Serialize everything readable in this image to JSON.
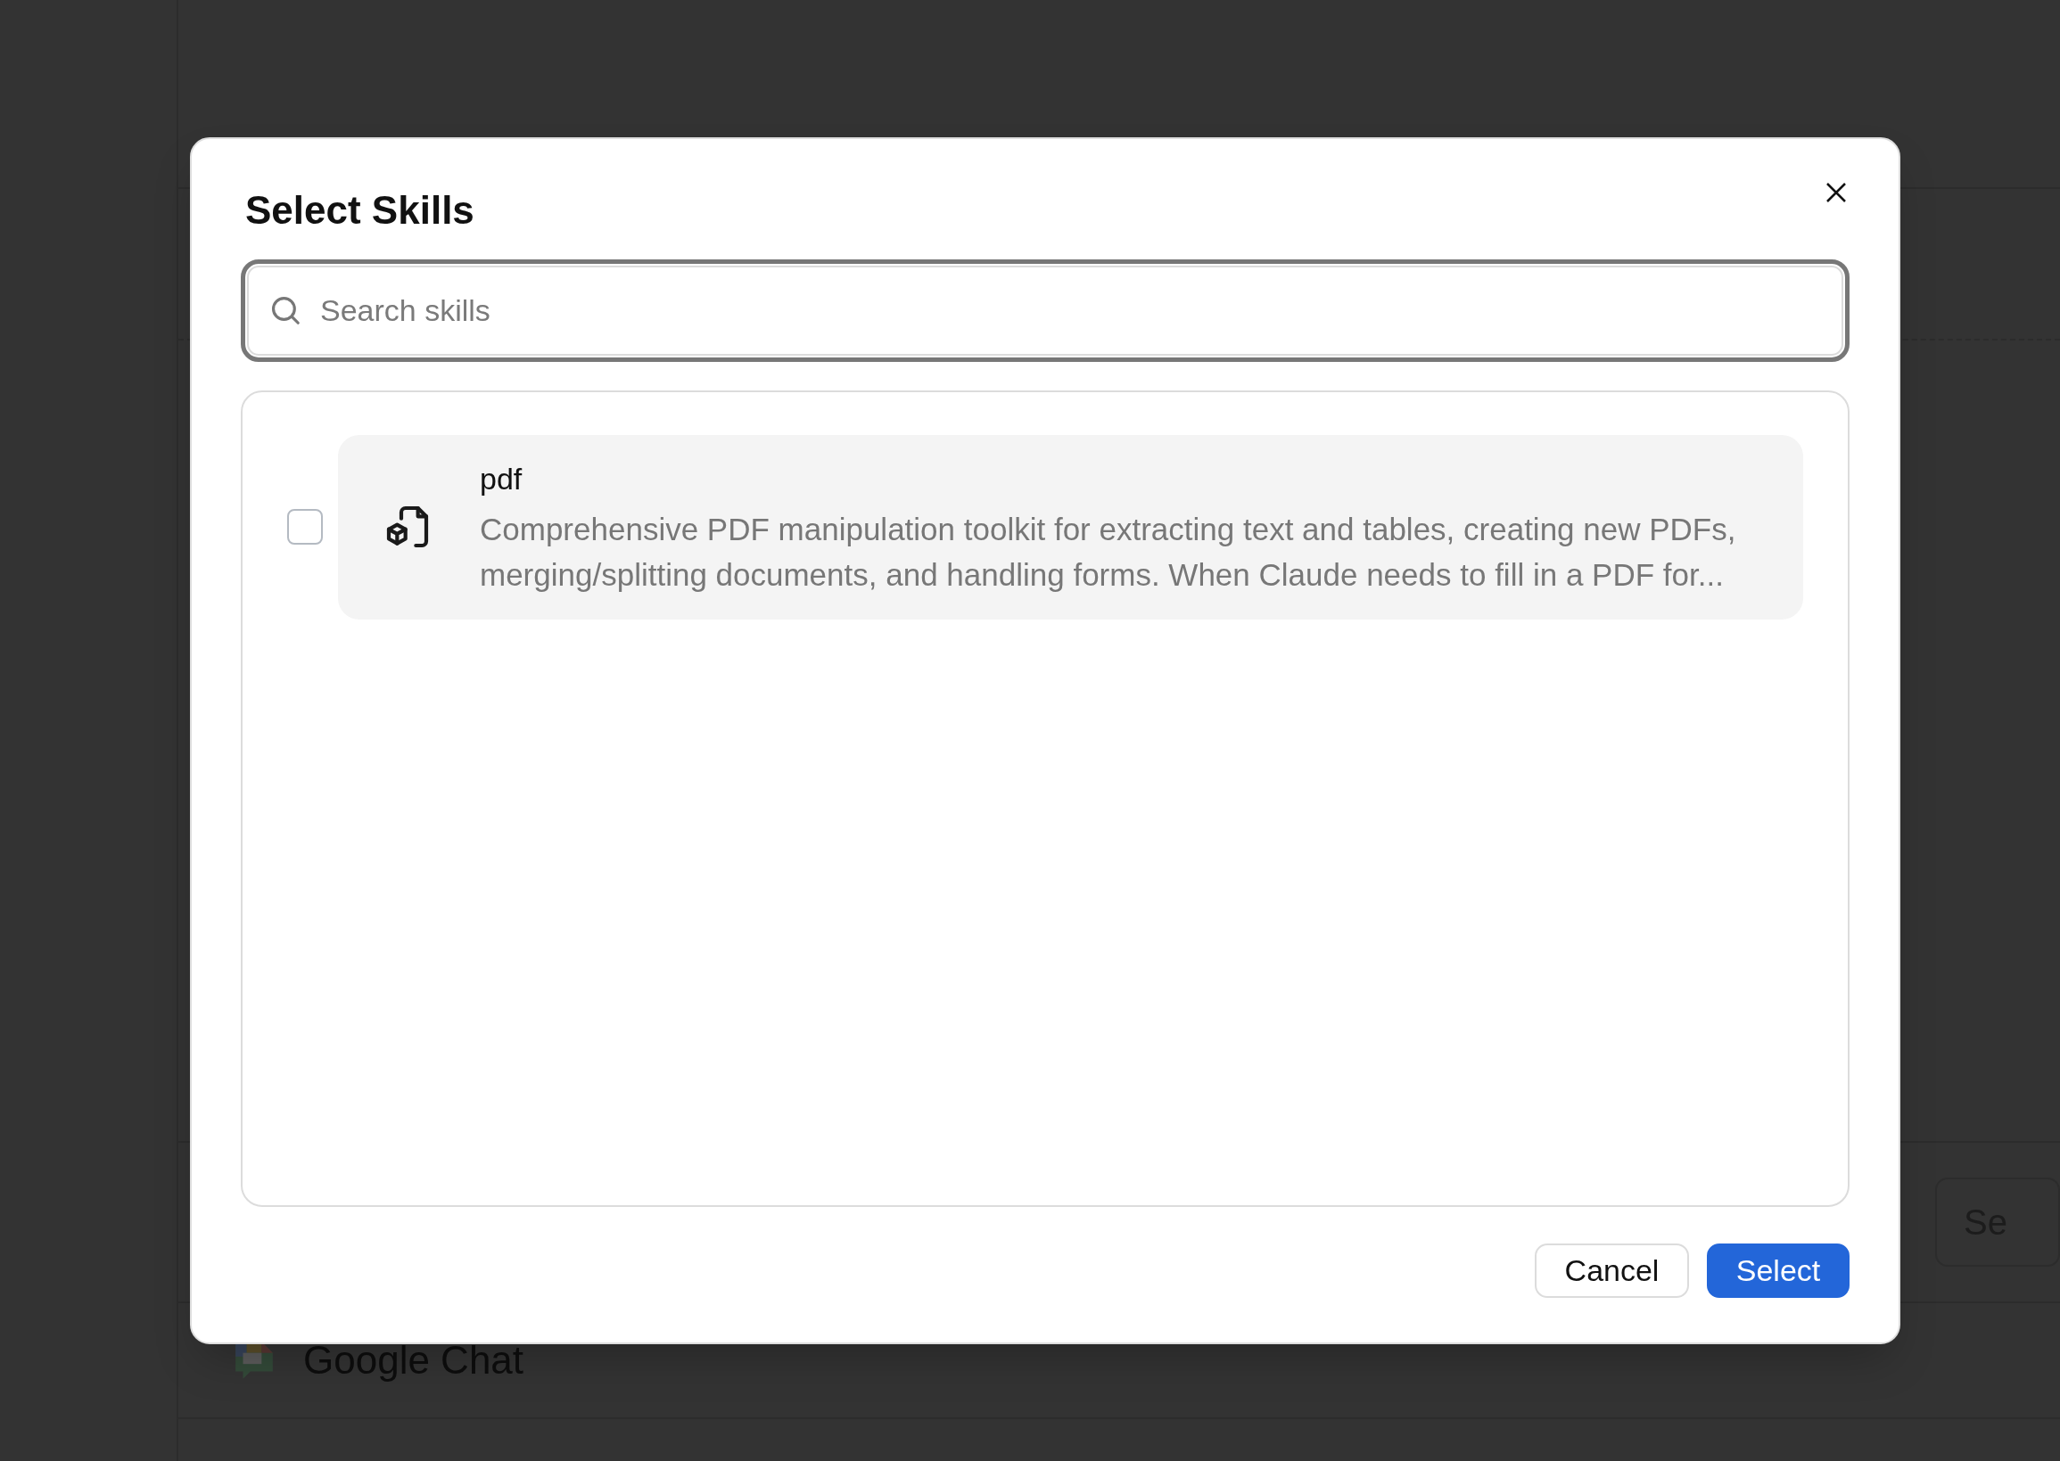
{
  "background": {
    "side_button": "Se",
    "integrations": [
      {
        "name": "Google Chat"
      }
    ]
  },
  "dialog": {
    "title": "Select Skills",
    "search": {
      "placeholder": "Search skills"
    },
    "skills": [
      {
        "name": "pdf",
        "description": "Comprehensive PDF manipulation toolkit for extracting text and tables, creating new PDFs, merging/splitting documents, and handling forms. When Claude needs to fill in a PDF for...",
        "checked": false
      }
    ],
    "buttons": [
      {
        "label": "Cancel",
        "kind": "secondary"
      },
      {
        "label": "Select",
        "kind": "primary"
      }
    ]
  }
}
